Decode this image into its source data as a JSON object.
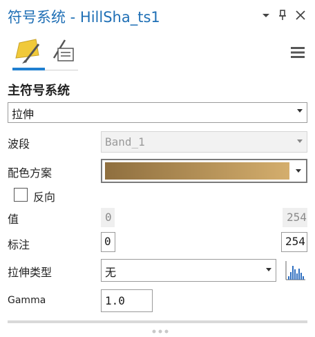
{
  "window": {
    "title": "符号系统 - HillSha_ts1"
  },
  "tabs": [
    {
      "icon": "paint-bucket-icon",
      "active": true
    },
    {
      "icon": "brush-list-icon",
      "active": false
    }
  ],
  "section": {
    "title": "主符号系统",
    "renderer": "拉伸"
  },
  "form": {
    "band_label": "波段",
    "band_value": "Band_1",
    "color_scheme_label": "配色方案",
    "color_ramp": [
      "#8f6f3f",
      "#d4ae6d"
    ],
    "invert_label": "反向",
    "invert_checked": false,
    "value_label": "值",
    "value_min": "0",
    "value_max": "254",
    "labels_label": "标注",
    "labels_min": "0",
    "labels_max": "254",
    "stretch_type_label": "拉伸类型",
    "stretch_type_value": "无",
    "gamma_label": "Gamma",
    "gamma_value": "1.0"
  }
}
